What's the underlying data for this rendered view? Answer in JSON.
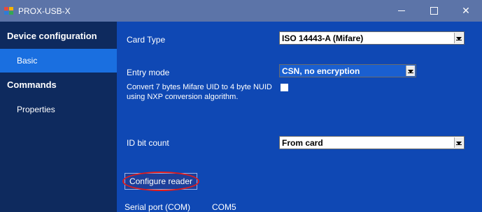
{
  "window": {
    "title": "PROX-USB-X",
    "icon": "app-grid-icon",
    "controls": [
      "minimize-icon",
      "maximize-icon",
      "close-icon"
    ],
    "close_glyph": "✕"
  },
  "sidebar": {
    "items": [
      {
        "label": "Device configuration",
        "type": "heading"
      },
      {
        "label": "Basic",
        "type": "sub",
        "active": true
      },
      {
        "label": "Commands",
        "type": "heading"
      },
      {
        "label": "Properties",
        "type": "sub"
      }
    ]
  },
  "main": {
    "card_type": {
      "label": "Card Type",
      "value": "ISO 14443-A (Mifare)"
    },
    "entry_mode": {
      "label": "Entry mode",
      "value": "CSN, no encryption"
    },
    "convert_option": {
      "line1": "Convert 7 bytes Mifare UID to 4 byte NUID",
      "line2": "using NXP conversion algorithm.",
      "checked": false
    },
    "id_bit_count": {
      "label": "ID bit count",
      "value": "From card"
    },
    "configure_button": "Configure reader"
  },
  "footer": {
    "serial_port_label": "Serial port (COM)",
    "serial_port_value": "COM5"
  },
  "colors": {
    "titlebar": "#5c74a8",
    "sidebar": "#0e2a5e",
    "sidebar_active": "#1a6fe0",
    "main": "#0f48b4",
    "highlight_ring": "#e21b1b"
  }
}
